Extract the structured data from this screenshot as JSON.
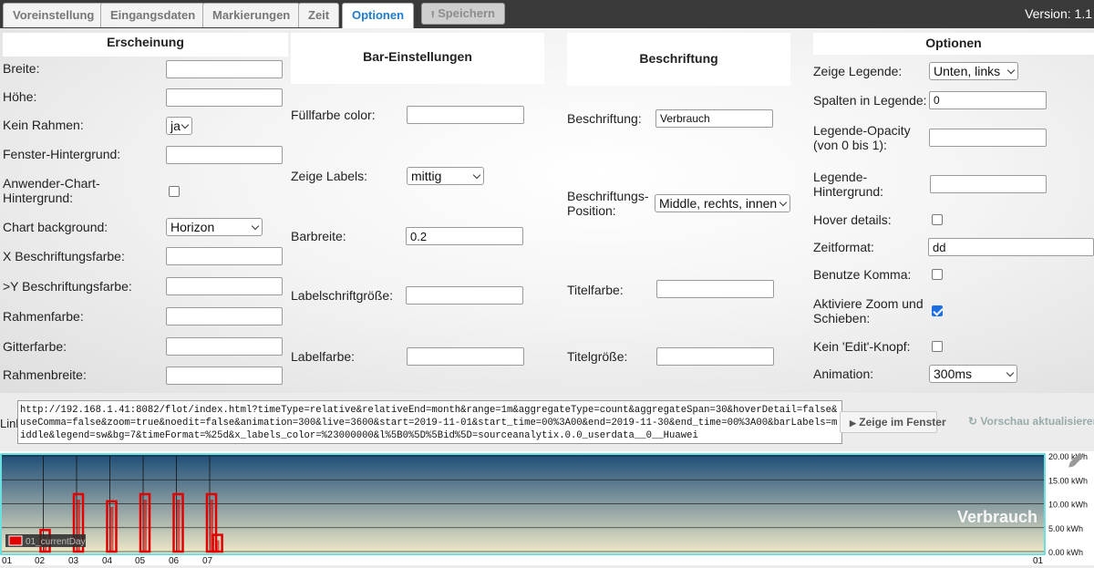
{
  "tabs": [
    {
      "label": "Voreinstellung"
    },
    {
      "label": "Eingangsdaten"
    },
    {
      "label": "Markierungen"
    },
    {
      "label": "Zeit"
    },
    {
      "label": "Optionen"
    },
    {
      "label": "Speichern"
    }
  ],
  "version": "Version: 1.1",
  "appearance": {
    "title": "Erscheinung",
    "width_label": "Breite:",
    "height_label": "Höhe:",
    "no_border_label": "Kein Rahmen:",
    "no_border_value": "ja",
    "window_bg_label": "Fenster-Hintergrund:",
    "user_chart_bg_label_1": "Anwender-Chart-",
    "user_chart_bg_label_2": "Hintergrund:",
    "chart_bg_label": "Chart background:",
    "chart_bg_value": "Horizon",
    "x_label_color_label": "X Beschriftungsfarbe:",
    "y_label_color_label": ">Y Beschriftungsfarbe:",
    "border_color_label": "Rahmenfarbe:",
    "grid_color_label": "Gitterfarbe:",
    "border_width_label": "Rahmenbreite:"
  },
  "bar": {
    "title": "Bar-Einstellungen",
    "fill_label": "Füllfarbe color:",
    "show_labels_label": "Zeige Labels:",
    "show_labels_value": "mittig",
    "bar_width_label": "Barbreite:",
    "bar_width_value": "0.2",
    "label_font_size_label": "Labelschriftgröße:",
    "label_color_label": "Labelfarbe:"
  },
  "caption": {
    "title": "Beschriftung",
    "caption_label": "Beschriftung:",
    "caption_value": "Verbrauch",
    "position_label_1": "Beschriftungs-",
    "position_label_2": "Position:",
    "position_value": "Middle, rechts, innen",
    "title_color_label": "Titelfarbe:",
    "title_size_label": "Titelgröße:"
  },
  "options": {
    "title": "Optionen",
    "show_legend_label": "Zeige Legende:",
    "show_legend_value": "Unten, links",
    "legend_columns_label": "Spalten in Legende:",
    "legend_columns_value": "0",
    "legend_opacity_label_1": "Legende-Opacity",
    "legend_opacity_label_2": "(von 0 bis 1):",
    "legend_bg_label_1": "Legende-",
    "legend_bg_label_2": "Hintergrund:",
    "hover_label": "Hover details:",
    "time_format_label": "Zeitformat:",
    "time_format_value": "dd",
    "use_comma_label": "Benutze Komma:",
    "zoom_label_1": "Aktiviere Zoom und",
    "zoom_label_2": "Schieben:",
    "no_edit_label": "Kein 'Edit'-Knopf:",
    "animation_label": "Animation:",
    "animation_value": "300ms"
  },
  "link": {
    "label": "Link",
    "url": "http://192.168.1.41:8082/flot/index.html?timeType=relative&relativeEnd=month&range=1m&aggregateType=count&aggregateSpan=30&hoverDetail=false&useComma=false&zoom=true&noedit=false&animation=300&live=3600&start=2019-11-01&start_time=00%3A00&end=2019-11-30&end_time=00%3A00&barLabels=middle&legend=sw&bg=7&timeFormat=%25d&x_labels_color=%23000000&l%5B0%5D%5Bid%5D=sourceanalytix.0.0_userdata__0__Huawei",
    "show_window_label": "Zeige im Fenster",
    "refresh_label": "Vorschau aktualisieren"
  },
  "colors": {
    "accent": "#1d7ccf",
    "chart_top": "#1f4e78",
    "chart_bottom": "#efe9c8",
    "bar_fill": "#e00000",
    "chart_border": "#39d6d6"
  },
  "chart_data": {
    "type": "bar",
    "caption": "Verbrauch",
    "legend": [
      {
        "name": "01_currentDay",
        "color": "#e00000"
      }
    ],
    "legend_position": "bottom-left",
    "ylim": [
      0,
      20
    ],
    "y_ticks": [
      "20.00 kWh",
      "15.00 kWh",
      "10.00 kWh",
      "5.00 kWh",
      "0.00 kWh"
    ],
    "x_tick_labels": [
      "01",
      "02",
      "03",
      "04",
      "05",
      "06",
      "07",
      "01"
    ],
    "series": [
      {
        "name": "01_currentDay",
        "bars": [
          {
            "x": 2,
            "value": 4.5
          },
          {
            "x": 3,
            "value": 12
          },
          {
            "x": 4,
            "value": 10.5
          },
          {
            "x": 5,
            "value": 12
          },
          {
            "x": 6,
            "value": 12
          },
          {
            "x": 7,
            "value": 12
          },
          {
            "x": 7.4,
            "value": 3.5
          }
        ]
      }
    ]
  }
}
